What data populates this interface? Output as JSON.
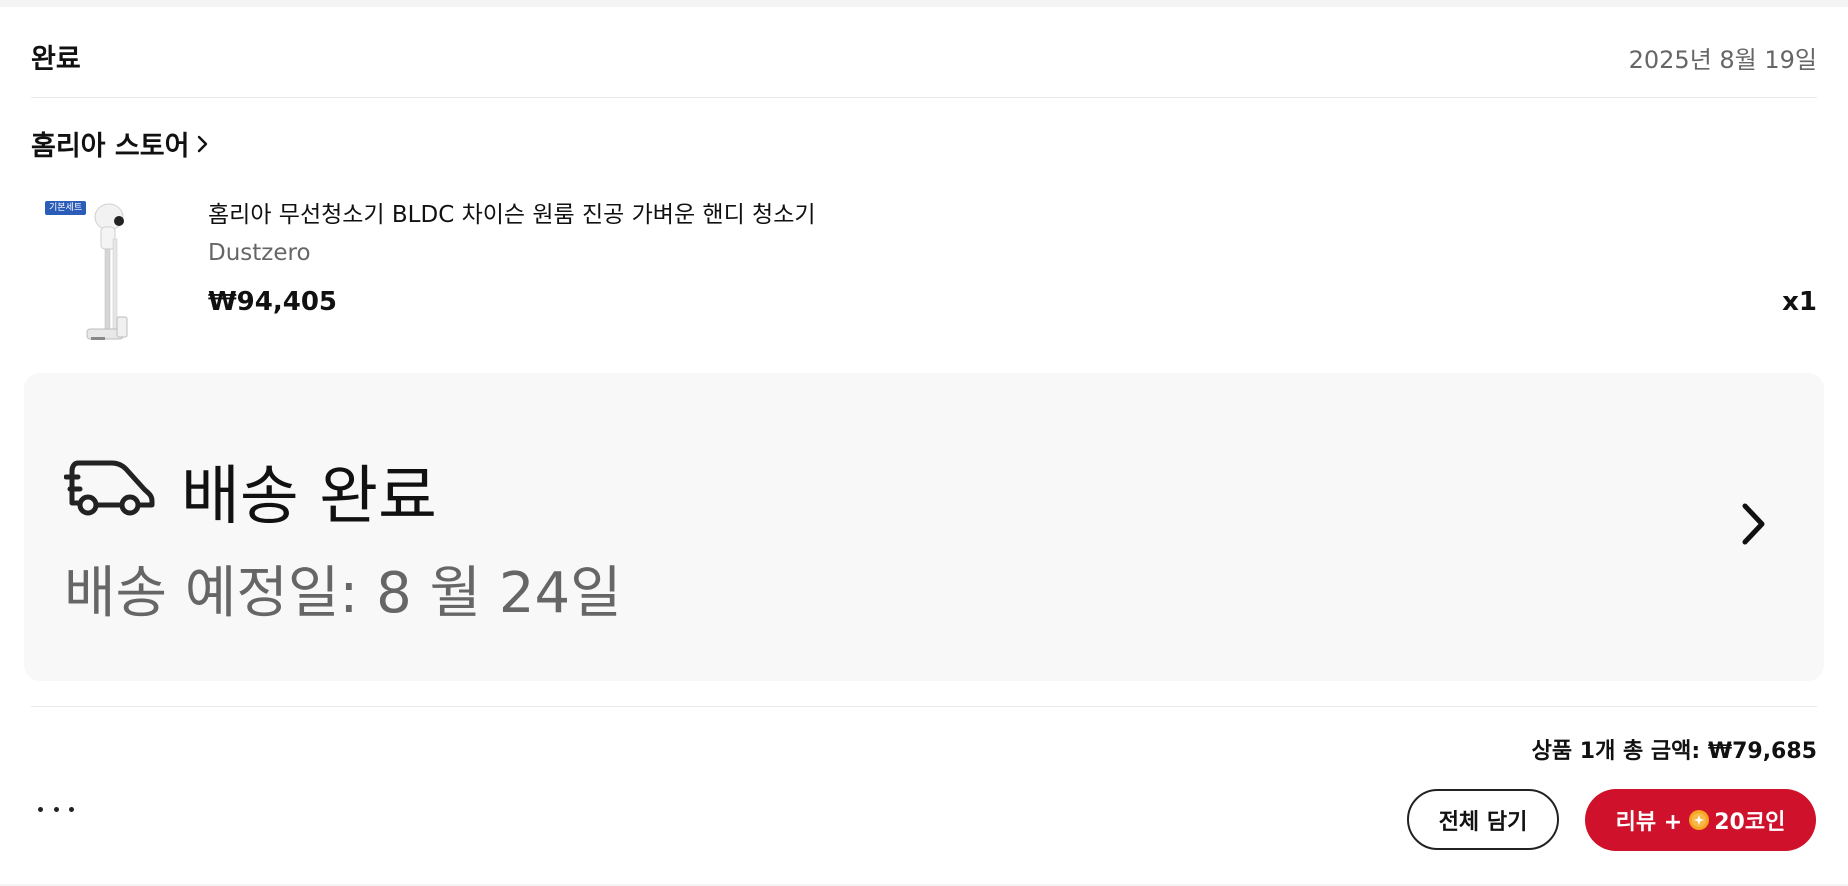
{
  "order": {
    "status": "완료",
    "date": "2025년 8월 19일"
  },
  "store": {
    "name": "홈리아 스토어",
    "chevron_icon": "chevron-right-icon"
  },
  "product": {
    "badge": "기본세트",
    "title": "홈리아 무선청소기 BLDC 차이슨 원룸 진공 가벼운 핸디 청소기",
    "brand": "Dustzero",
    "price": "₩94,405",
    "quantity": "x1"
  },
  "delivery": {
    "icon": "truck-icon",
    "status": "배송 완료",
    "eta": "배송 예정일: 8 월 24일"
  },
  "summary": {
    "total_text": "상품 1개 총 금액: ₩79,685"
  },
  "actions": {
    "more_icon": "more-horizontal-icon",
    "cart_label": "전체 담기",
    "review_prefix": "리뷰 +",
    "review_suffix": "20코인"
  },
  "colors": {
    "accent": "#d0112b",
    "badge": "#2a5cb8",
    "muted_text": "#666666",
    "panel_bg": "#f8f8f8"
  }
}
